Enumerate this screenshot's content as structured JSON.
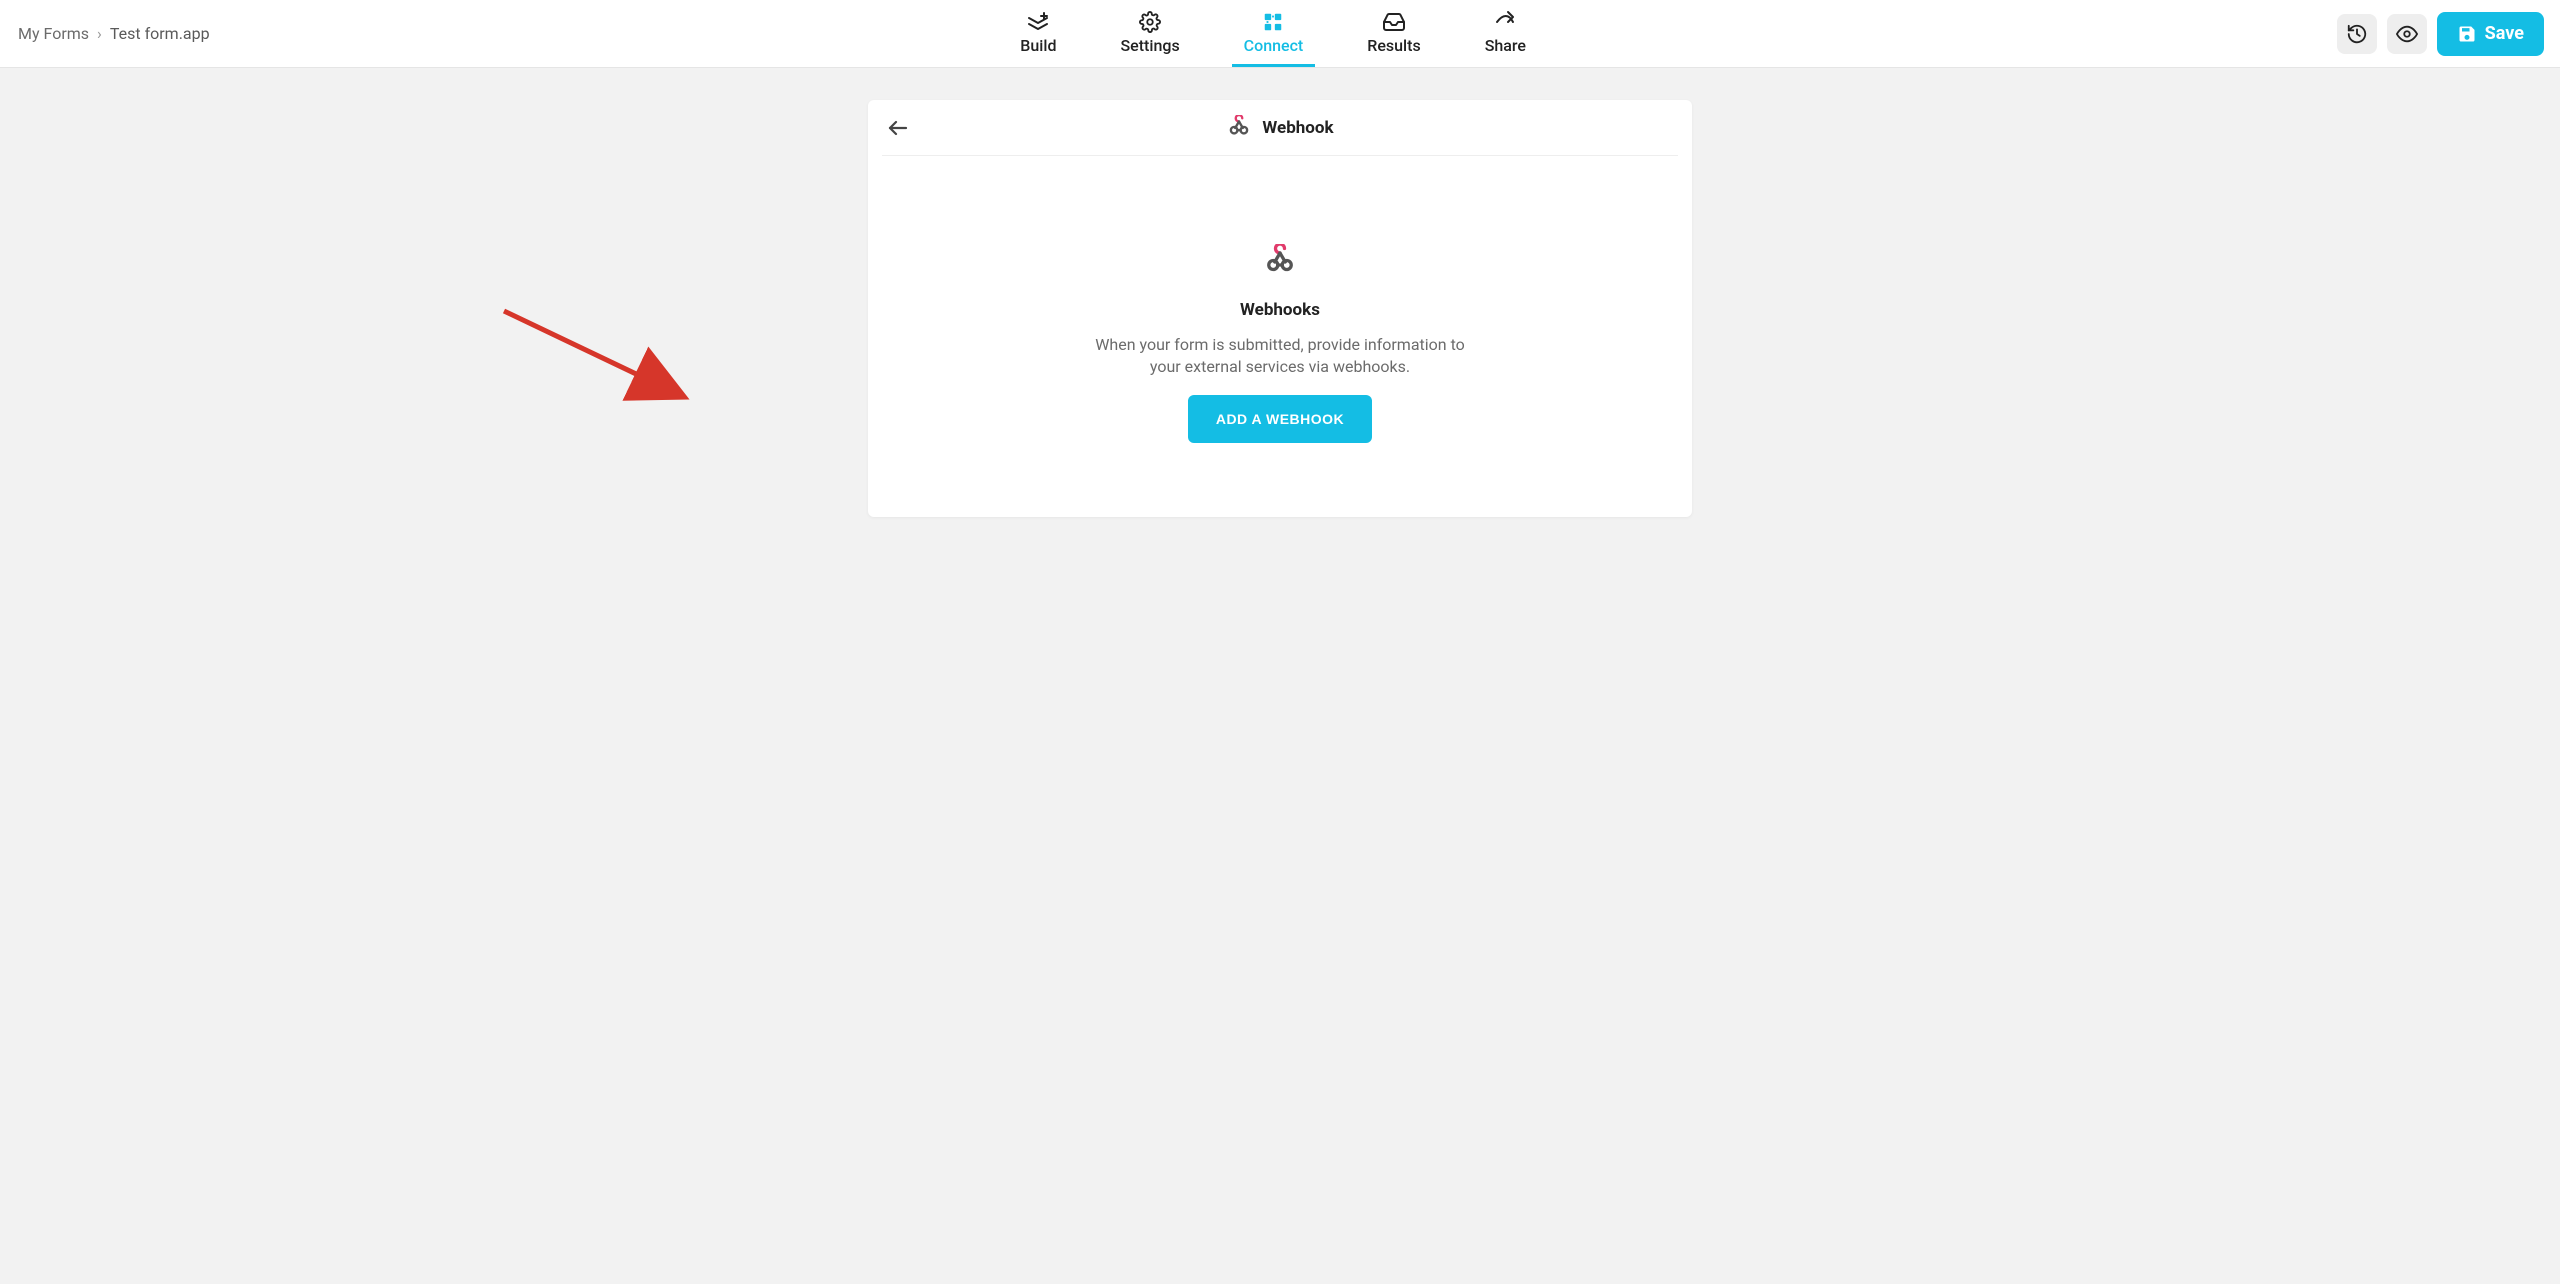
{
  "breadcrumb": {
    "root": "My Forms",
    "current": "Test form.app"
  },
  "tabs": {
    "build": "Build",
    "settings": "Settings",
    "connect": "Connect",
    "results": "Results",
    "share": "Share"
  },
  "actions": {
    "save": "Save"
  },
  "panel": {
    "header_title": "Webhook",
    "title": "Webhooks",
    "description": "When your form is submitted, provide information to your external services via webhooks.",
    "add_button": "ADD A WEBHOOK"
  },
  "colors": {
    "accent": "#14bde4",
    "arrow": "#d6362a"
  }
}
